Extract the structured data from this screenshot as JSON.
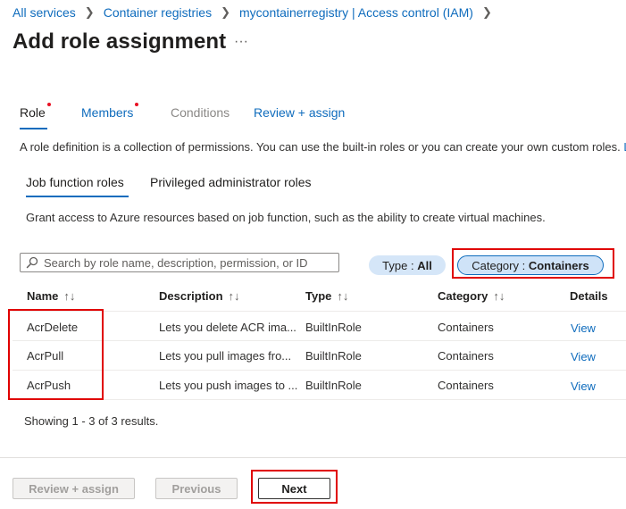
{
  "breadcrumb": {
    "items": [
      "All services",
      "Container registries",
      "mycontainerregistry | Access control (IAM)"
    ]
  },
  "page": {
    "title": "Add role assignment",
    "more_label": "···"
  },
  "tabs": [
    {
      "label": "Role",
      "state": "active",
      "required": true
    },
    {
      "label": "Members",
      "state": "link",
      "required": true
    },
    {
      "label": "Conditions",
      "state": "disabled",
      "required": false
    },
    {
      "label": "Review + assign",
      "state": "link",
      "required": false
    }
  ],
  "description": "A role definition is a collection of permissions. You can use the built-in roles or you can create your own custom roles.",
  "description_more": "L",
  "subtabs": [
    {
      "label": "Job function roles",
      "active": true
    },
    {
      "label": "Privileged administrator roles",
      "active": false
    }
  ],
  "subtab_description": "Grant access to Azure resources based on job function, such as the ability to create virtual machines.",
  "search": {
    "placeholder": "Search by role name, description, permission, or ID",
    "value": "",
    "icon": "search-icon"
  },
  "filters": {
    "type": {
      "label": "Type :",
      "value": "All"
    },
    "category": {
      "label": "Category :",
      "value": "Containers"
    }
  },
  "table": {
    "columns": [
      "Name",
      "Description",
      "Type",
      "Category",
      "Details"
    ],
    "sort_glyph": "↑↓",
    "rows": [
      {
        "name": "AcrDelete",
        "description": "Lets you delete ACR ima...",
        "type": "BuiltInRole",
        "category": "Containers",
        "details": "View"
      },
      {
        "name": "AcrPull",
        "description": "Lets you pull images fro...",
        "type": "BuiltInRole",
        "category": "Containers",
        "details": "View"
      },
      {
        "name": "AcrPush",
        "description": "Lets you push images to ...",
        "type": "BuiltInRole",
        "category": "Containers",
        "details": "View"
      }
    ]
  },
  "results_text": "Showing 1 - 3 of 3 results.",
  "footer": {
    "review_label": "Review + assign",
    "previous_label": "Previous",
    "next_label": "Next"
  },
  "colors": {
    "accent": "#0f6cbd",
    "highlight_box": "#e00000",
    "required_dot": "#e81123",
    "pill_background": "#d5e6f8"
  }
}
